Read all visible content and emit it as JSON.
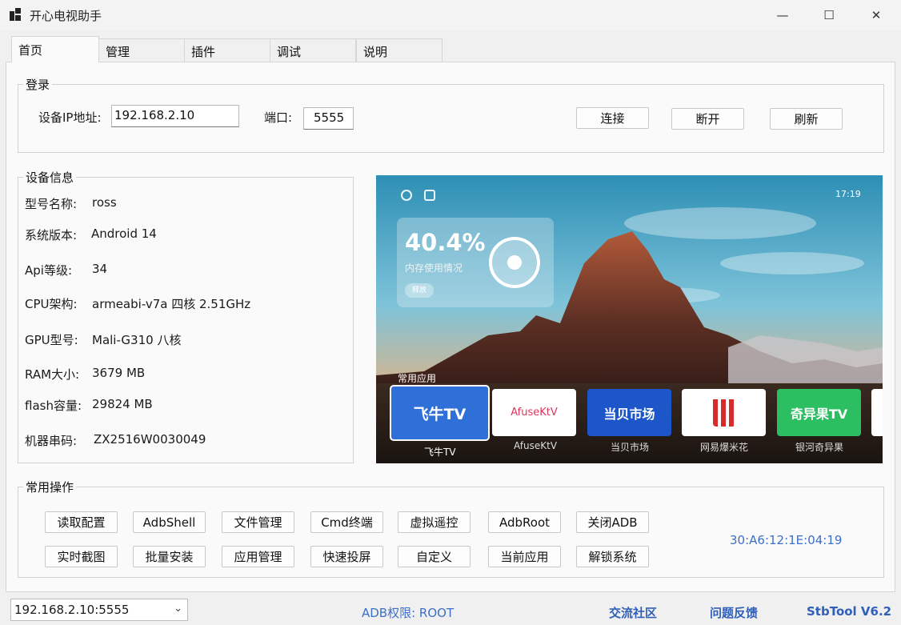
{
  "window": {
    "title": "开心电视助手",
    "minimize": "—",
    "maximize": "☐",
    "close": "✕"
  },
  "tabs": [
    "首页",
    "管理",
    "插件",
    "调试",
    "说明"
  ],
  "login": {
    "title": "登录",
    "ip_label": "设备IP地址:",
    "ip_value": "192.168.2.10",
    "port_label": "端口:",
    "port_value": "5555",
    "connect": "连接",
    "disconnect": "断开",
    "refresh": "刷新"
  },
  "device_info": {
    "title": "设备信息",
    "rows": [
      {
        "label": "型号名称:",
        "value": "ross"
      },
      {
        "label": "系统版本:",
        "value": "Android 14"
      },
      {
        "label": "Api等级:",
        "value": "34"
      },
      {
        "label": "CPU架构:",
        "value": "armeabi-v7a 四核 2.51GHz"
      },
      {
        "label": "GPU型号:",
        "value": "Mali-G310 八核"
      },
      {
        "label": "RAM大小:",
        "value": "3679 MB"
      },
      {
        "label": "flash容量:",
        "value": "29824 MB"
      },
      {
        "label": "机器串码:",
        "value": "ZX2516W0030049"
      }
    ]
  },
  "tv_screen": {
    "time": "17:19",
    "memory_percent": "40.4%",
    "memory_label": "内存使用情况",
    "release_button": "释放",
    "section_label": "常用应用",
    "apps": [
      {
        "tile_text": "飞牛TV",
        "caption": "飞牛TV",
        "bg": "#2f6fd8"
      },
      {
        "tile_text": "AfuseKtV",
        "caption": "AfuseKtV",
        "bg": "#ffffff"
      },
      {
        "tile_text": "当贝市场",
        "caption": "当贝市场",
        "bg": "#1c56c8"
      },
      {
        "tile_text": "",
        "caption": "网易爆米花",
        "bg": "#ffffff"
      },
      {
        "tile_text": "奇异果TV",
        "caption": "银河奇异果",
        "bg": "#2cbf62"
      }
    ]
  },
  "operations": {
    "title": "常用操作",
    "row1": [
      "读取配置",
      "AdbShell",
      "文件管理",
      "Cmd终端",
      "虚拟遥控",
      "AdbRoot",
      "关闭ADB"
    ],
    "row2": [
      "实时截图",
      "批量安装",
      "应用管理",
      "快速投屏",
      "自定义",
      "当前应用",
      "解锁系统"
    ],
    "mac": "30:A6:12:1E:04:19"
  },
  "statusbar": {
    "device_select": "192.168.2.10:5555",
    "adb_permission": "ADB权限:  ROOT",
    "community": "交流社区",
    "feedback": "问题反馈",
    "version": "StbTool V6.2"
  }
}
